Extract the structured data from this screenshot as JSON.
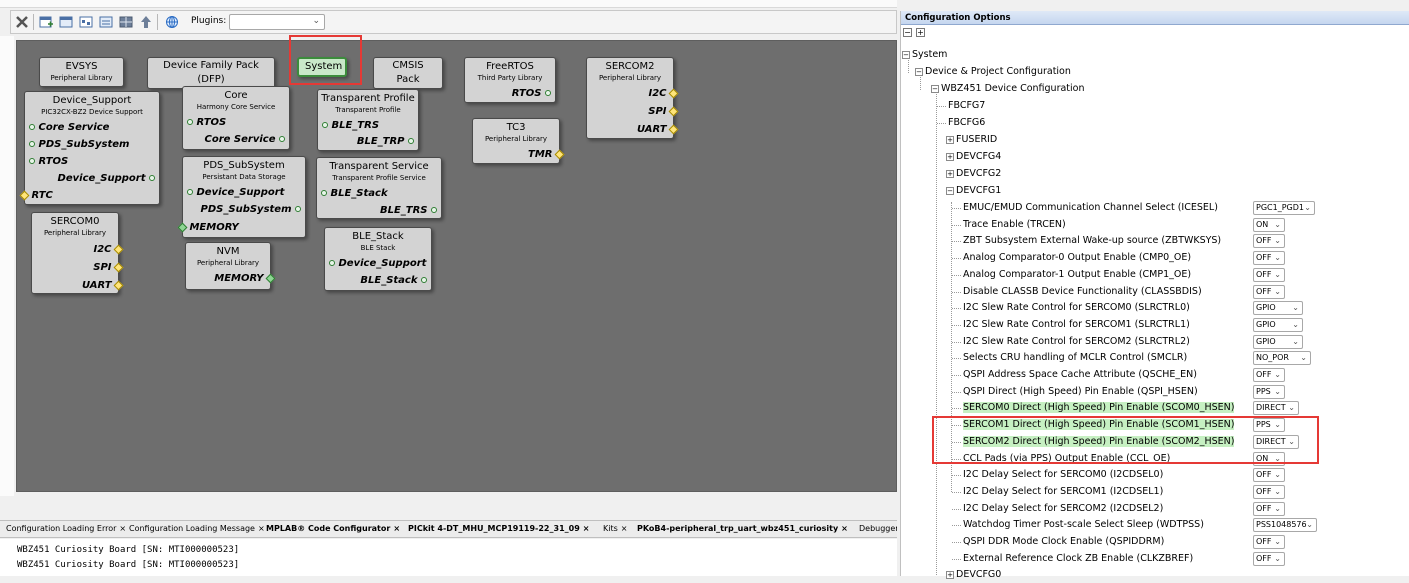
{
  "toolbar": {
    "plugins_label": "Plugins:",
    "plugins_value": "",
    "icons": [
      "close-icon",
      "add-component-icon",
      "component-icon",
      "graph-icon",
      "component-list-icon",
      "grid-icon",
      "up-arrow-icon",
      "globe-icon"
    ]
  },
  "canvas": {
    "nodes": {
      "evsys": {
        "title": "EVSYS",
        "subtitle": "Peripheral Library"
      },
      "dfp": {
        "title": "Device Family Pack (DFP)"
      },
      "system": {
        "title": "System"
      },
      "cmsis": {
        "title": "CMSIS Pack"
      },
      "freertos": {
        "title": "FreeRTOS",
        "subtitle": "Third Party Library",
        "rows": [
          "RTOS"
        ]
      },
      "sercom2": {
        "title": "SERCOM2",
        "subtitle": "Peripheral Library",
        "rows": [
          "I2C",
          "SPI",
          "UART"
        ]
      },
      "device_support": {
        "title": "Device_Support",
        "subtitle": "PIC32CX-BZ2 Device Support",
        "rows": [
          "Core Service",
          "PDS_SubSystem",
          "RTOS",
          "Device_Support",
          "RTC"
        ]
      },
      "core": {
        "title": "Core",
        "subtitle": "Harmony Core Service",
        "rows": [
          "RTOS",
          "Core Service"
        ]
      },
      "transparent_profile": {
        "title": "Transparent Profile",
        "subtitle": "Transparent Profile",
        "rows": [
          "BLE_TRS",
          "BLE_TRP"
        ]
      },
      "tc3": {
        "title": "TC3",
        "subtitle": "Peripheral Library",
        "rows": [
          "TMR"
        ]
      },
      "pds": {
        "title": "PDS_SubSystem",
        "subtitle": "Persistant Data Storage",
        "rows": [
          "Device_Support",
          "PDS_SubSystem",
          "MEMORY"
        ]
      },
      "transparent_service": {
        "title": "Transparent Service",
        "subtitle": "Transparent Profile Service",
        "rows": [
          "BLE_Stack",
          "BLE_TRS"
        ]
      },
      "sercom0": {
        "title": "SERCOM0",
        "subtitle": "Peripheral Library",
        "rows": [
          "I2C",
          "SPI",
          "UART"
        ]
      },
      "nvm": {
        "title": "NVM",
        "subtitle": "Peripheral Library",
        "rows": [
          "MEMORY"
        ]
      },
      "ble_stack": {
        "title": "BLE_Stack",
        "subtitle": "BLE Stack",
        "rows": [
          "Device_Support",
          "BLE_Stack"
        ]
      }
    }
  },
  "bottom_tabs": [
    {
      "label": "Configuration Loading Error",
      "close": "×"
    },
    {
      "label": "Configuration Loading Message",
      "close": "×"
    },
    {
      "label": "MPLAB® Code Configurator",
      "close": "×"
    },
    {
      "label": "PICkit 4-DT_MHU_MCP19119-22_31_09",
      "close": "×"
    },
    {
      "label": "Kits",
      "close": "×"
    },
    {
      "label": "PKoB4-peripheral_trp_uart_wbz451_curiosity",
      "close": "×"
    },
    {
      "label": "Debugger",
      "close": ""
    }
  ],
  "output_lines": [
    "WBZ451 Curiosity Board [SN: MTI000000523]",
    "WBZ451 Curiosity Board [SN: MTI000000523]"
  ],
  "config": {
    "header": "Configuration Options",
    "collapse_all": "−",
    "expand_all": "+",
    "tree": {
      "system": "System",
      "device_project": "Device & Project Configuration",
      "wbz": "WBZ451 Device Configuration",
      "fbcfg7": "FBCFG7",
      "fbcfg6": "FBCFG6",
      "fuserid": "FUSERID",
      "devcfg4": "DEVCFG4",
      "devcfg2": "DEVCFG2",
      "devcfg1": "DEVCFG1",
      "devcfg0": "DEVCFG0"
    },
    "options": [
      {
        "label": "EMUC/EMUD Communication Channel Select (ICESEL)",
        "value": "PGC1_PGD1"
      },
      {
        "label": "Trace Enable (TRCEN)",
        "value": "ON"
      },
      {
        "label": "ZBT Subsystem External Wake-up source (ZBTWKSYS)",
        "value": "OFF"
      },
      {
        "label": "Analog Comparator-0 Output Enable (CMP0_OE)",
        "value": "OFF"
      },
      {
        "label": "Analog Comparator-1 Output Enable (CMP1_OE)",
        "value": "OFF"
      },
      {
        "label": "Disable CLASSB Device Functionality (CLASSBDIS)",
        "value": "OFF"
      },
      {
        "label": "I2C Slew Rate Control for SERCOM0 (SLRCTRL0)",
        "value": "GPIO"
      },
      {
        "label": "I2C Slew Rate Control for SERCOM1 (SLRCTRL1)",
        "value": "GPIO"
      },
      {
        "label": "I2C Slew Rate Control for SERCOM2 (SLRCTRL2)",
        "value": "GPIO"
      },
      {
        "label": "Selects CRU handling of MCLR Control (SMCLR)",
        "value": "NO_POR"
      },
      {
        "label": "QSPI Address Space Cache Attribute (QSCHE_EN)",
        "value": "OFF"
      },
      {
        "label": "QSPI Direct (High Speed) Pin Enable (QSPI_HSEN)",
        "value": "PPS"
      },
      {
        "label": "SERCOM0 Direct (High Speed) Pin Enable (SCOM0_HSEN)",
        "value": "DIRECT"
      },
      {
        "label": "SERCOM1 Direct (High Speed) Pin Enable (SCOM1_HSEN)",
        "value": "PPS"
      },
      {
        "label": "SERCOM2 Direct (High Speed) Pin Enable (SCOM2_HSEN)",
        "value": "DIRECT"
      },
      {
        "label": "CCL Pads (via PPS) Output Enable (CCL_OE)",
        "value": "ON"
      },
      {
        "label": "I2C Delay Select for SERCOM0 (I2CDSEL0)",
        "value": "OFF"
      },
      {
        "label": "I2C Delay Select for SERCOM1 (I2CDSEL1)",
        "value": "OFF"
      },
      {
        "label": "I2C Delay Select for SERCOM2 (I2CDSEL2)",
        "value": "OFF"
      },
      {
        "label": "Watchdog Timer Post-scale Select Sleep (WDTPSS)",
        "value": "PSS1048576"
      },
      {
        "label": "QSPI DDR Mode Clock Enable (QSPIDDRM)",
        "value": "OFF"
      },
      {
        "label": "External Reference Clock ZB Enable (CLKZBREF)",
        "value": "OFF"
      }
    ]
  },
  "colors": {
    "highlight_red": "#e53935",
    "modified_green": "#c6f0c2",
    "canvas_bg": "#6e6e6e"
  }
}
